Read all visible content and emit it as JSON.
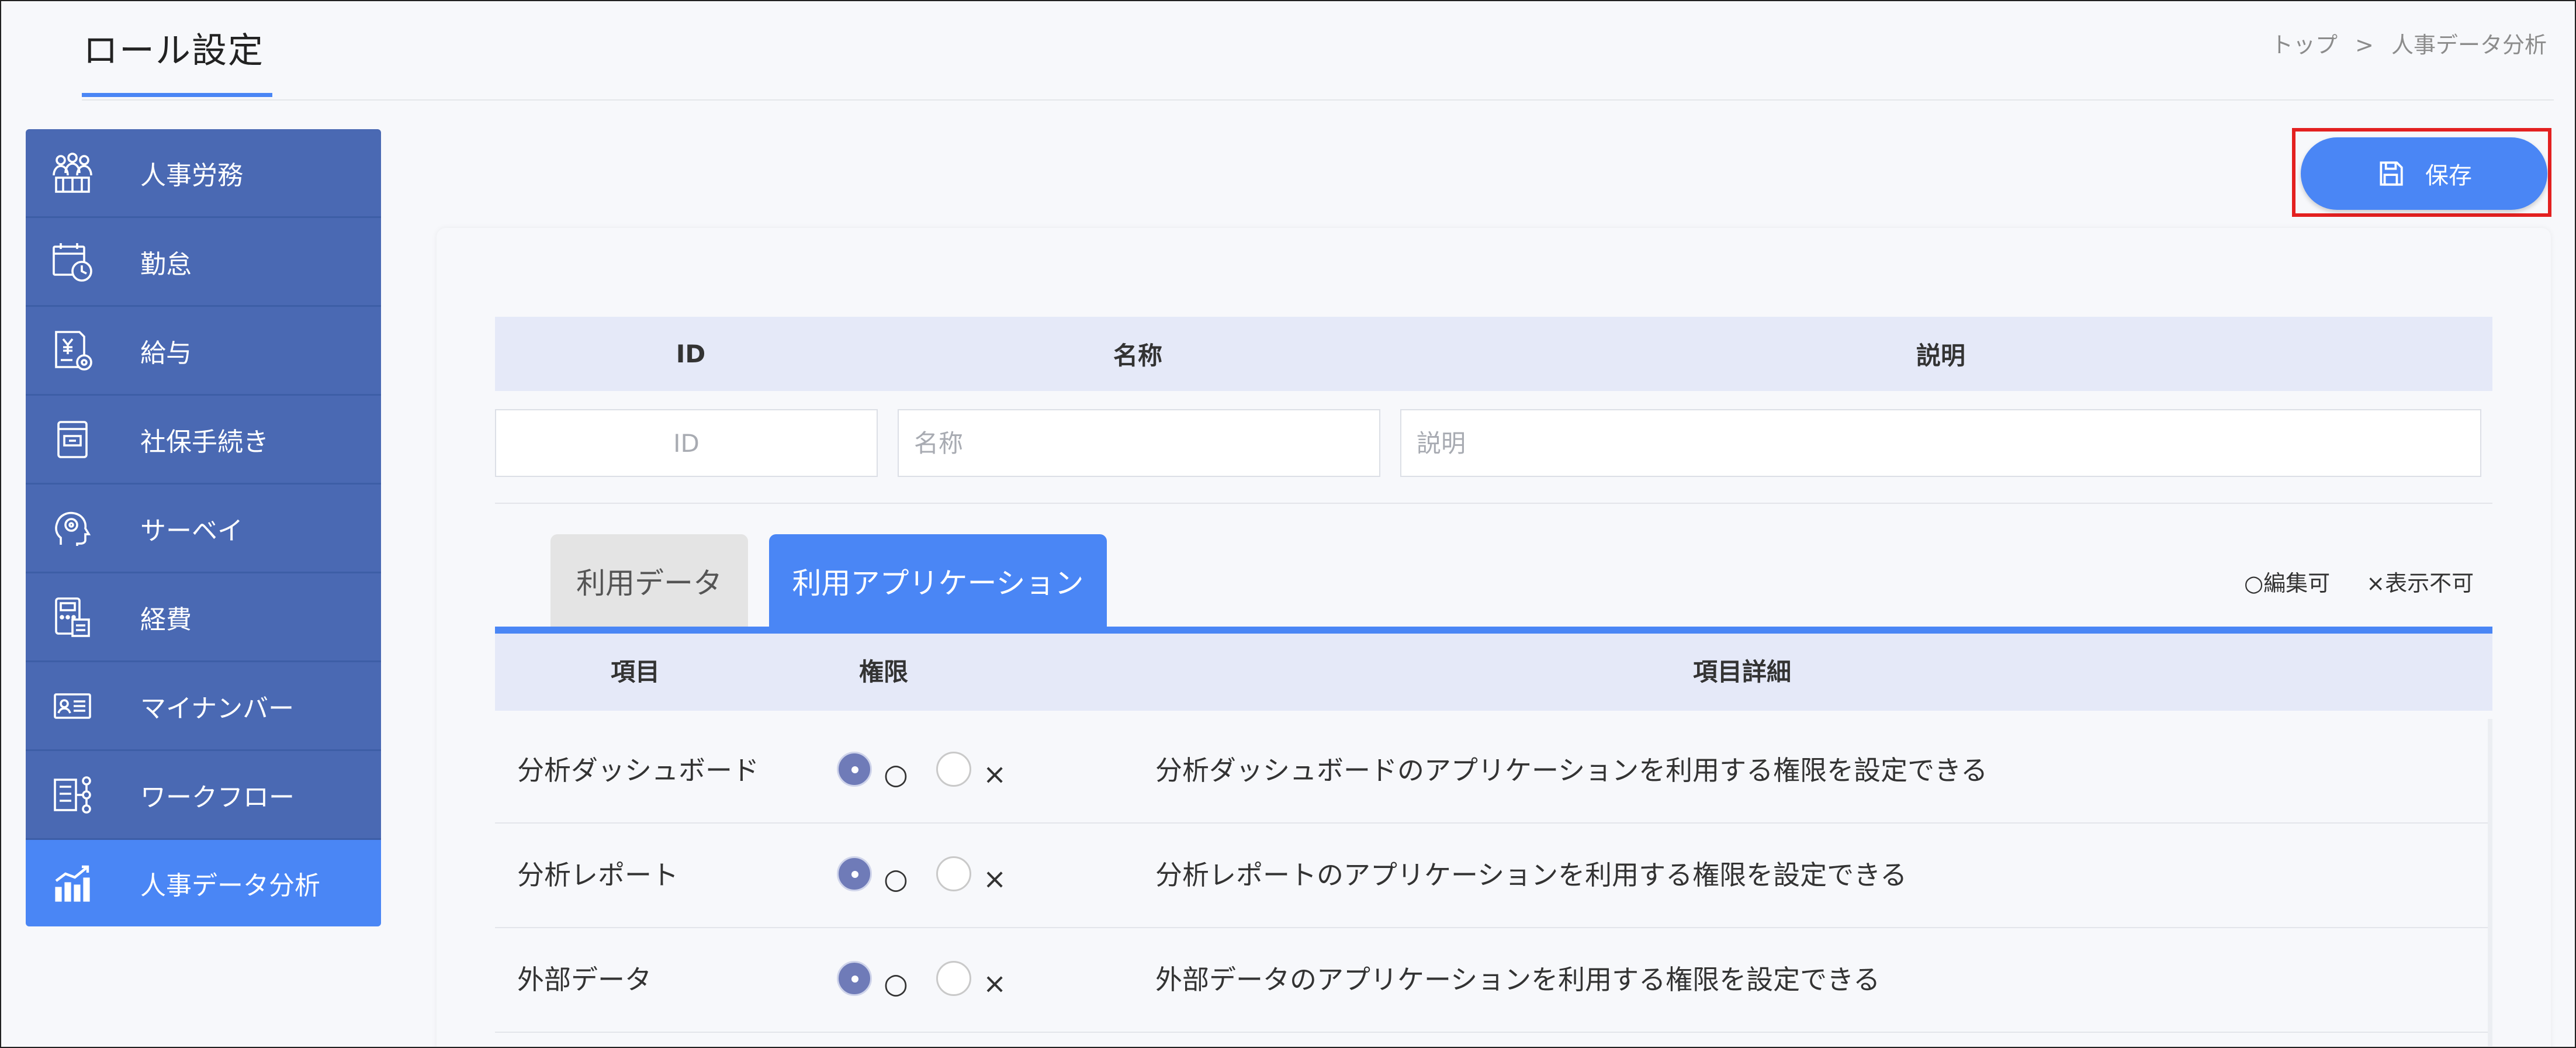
{
  "page": {
    "title": "ロール設定",
    "breadcrumb": [
      "トップ",
      ">",
      "人事データ分析"
    ]
  },
  "sidebar": {
    "items": [
      {
        "label": "人事労務",
        "icon": "people-group-icon"
      },
      {
        "label": "勤怠",
        "icon": "calendar-clock-icon"
      },
      {
        "label": "給与",
        "icon": "yen-document-icon"
      },
      {
        "label": "社保手続き",
        "icon": "inbox-tray-icon"
      },
      {
        "label": "サーベイ",
        "icon": "head-gear-icon"
      },
      {
        "label": "経費",
        "icon": "calculator-receipt-icon"
      },
      {
        "label": "マイナンバー",
        "icon": "id-card-icon"
      },
      {
        "label": "ワークフロー",
        "icon": "workflow-icon"
      },
      {
        "label": "人事データ分析",
        "icon": "bar-chart-trend-icon",
        "active": true
      }
    ]
  },
  "toolbar": {
    "save_label": "保存",
    "save_icon": "floppy-disk-icon"
  },
  "form": {
    "headers": {
      "id": "ID",
      "name": "名称",
      "description": "説明"
    },
    "placeholders": {
      "id": "ID",
      "name": "名称",
      "description": "説明"
    }
  },
  "tabs": [
    {
      "label": "利用データ",
      "active": false
    },
    {
      "label": "利用アプリケーション",
      "active": true
    }
  ],
  "legend": {
    "editable": "○編集可",
    "hidden": "×表示不可"
  },
  "permissions_table": {
    "headers": {
      "item": "項目",
      "permission": "権限",
      "detail": "項目詳細"
    },
    "radio_marks": {
      "allow": "○",
      "deny": "×"
    },
    "rows": [
      {
        "item": "分析ダッシュボード",
        "detail": "分析ダッシュボードのアプリケーションを利用する権限を設定できる",
        "selected": "allow"
      },
      {
        "item": "分析レポート",
        "detail": "分析レポートのアプリケーションを利用する権限を設定できる",
        "selected": "allow"
      },
      {
        "item": "外部データ",
        "detail": "外部データのアプリケーションを利用する権限を設定できる",
        "selected": "allow"
      }
    ]
  },
  "colors": {
    "accent": "#4a86f5",
    "sidebar": "#4a69b3",
    "header_row": "#e5e9f8",
    "highlight_border": "#e32020"
  }
}
